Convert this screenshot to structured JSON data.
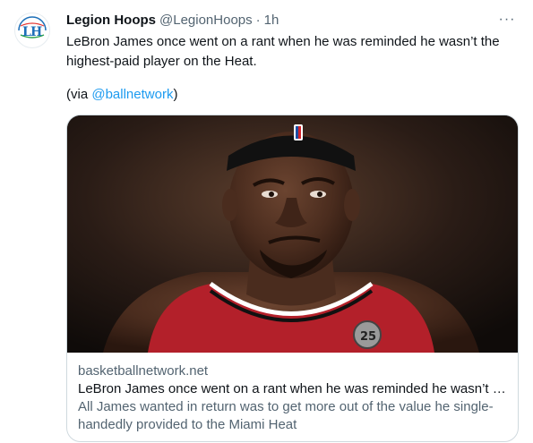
{
  "tweet": {
    "author_name": "Legion Hoops",
    "author_handle": "@LegionHoops",
    "separator": "·",
    "time": "1h",
    "more_label": "···",
    "text": "LeBron James once went on a rant when he was reminded he wasn’t the highest-paid player on the Heat.",
    "via_prefix": "(via ",
    "via_mention": "@ballnetwork",
    "via_suffix": ")",
    "avatar_icon": "legion-hoops-logo"
  },
  "card": {
    "domain": "basketballnetwork.net",
    "title": "LeBron James once went on a rant when he was reminded he wasn’t th...",
    "description": "All James wanted in return was to get more out of the value he single-handedly provided to the Miami Heat",
    "image_subject": "basketball player in red jersey with black headband"
  },
  "colors": {
    "link": "#1d9bf0",
    "secondary_text": "#536471",
    "border": "#cfd9de",
    "jersey_red": "#b3202a"
  }
}
